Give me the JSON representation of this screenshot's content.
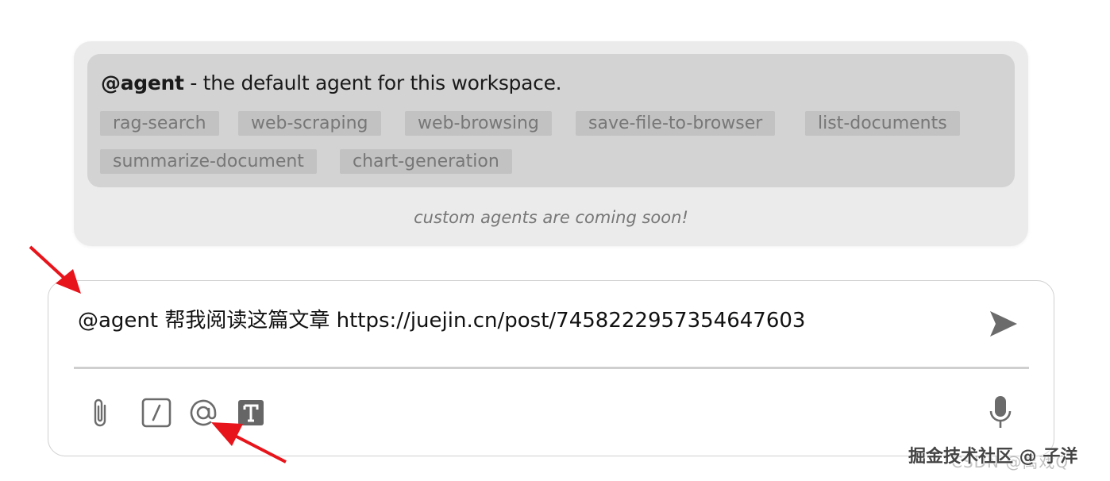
{
  "agent_popup": {
    "agent_name": "@agent",
    "agent_description": " - the default agent for this workspace.",
    "tools": [
      "rag-search",
      "web-scraping",
      "web-browsing",
      "save-file-to-browser",
      "list-documents",
      "summarize-document",
      "chart-generation"
    ],
    "footer_note": "custom agents are coming soon!"
  },
  "prompt_input": {
    "value": "@agent 帮我阅读这篇文章 https://juejin.cn/post/7458222957354647603"
  },
  "toolbar": {
    "icons": [
      "paperclip-icon",
      "slash-command-icon",
      "at-mention-icon",
      "text-format-icon",
      "microphone-icon",
      "send-icon"
    ]
  },
  "watermark": {
    "text": "掘金技术社区 @ 子洋",
    "secondary": "CSDN @禹戏Q"
  },
  "colors": {
    "popup_bg": "#ebebeb",
    "card_bg": "#d3d3d3",
    "tag_bg": "#c2c2c2",
    "tag_text": "#777777",
    "arrow": "#e8141b"
  }
}
